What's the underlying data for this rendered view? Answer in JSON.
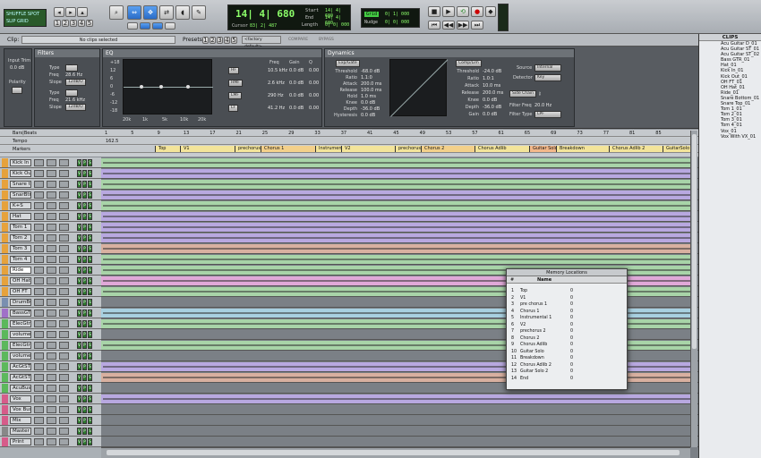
{
  "toolbar": {
    "mode_top": "SHUFFLE SPOT",
    "mode_bottom": "SLIP GRID",
    "main_counter": "14| 4| 680",
    "cursor_label": "Cursor",
    "cursor_value": "83| 2| 487",
    "start_label": "Start",
    "start_value": "14| 4| 680",
    "end_label": "End",
    "end_value": "14| 4| 680",
    "length_label": "Length",
    "length_value": "0| 0| 000",
    "grid_label": "Grid",
    "grid_value": "0| 1| 000",
    "nudge_label": "Nudge",
    "nudge_value": "0| 0| 000",
    "dly": "Dly"
  },
  "editbar": {
    "clip_label": "Clip:",
    "clip_value": "No clips selected",
    "presets_label": "Presets:",
    "preset_value": "<factory default>",
    "compare": "COMPARE",
    "bypass": "BYPASS"
  },
  "filters": {
    "title": "Filters",
    "input_trim_label": "Input Trim",
    "input_trim_value": "0.0 dB",
    "polarity_label": "Polarity",
    "rows": [
      {
        "type": "Type",
        "freq": "Freq",
        "freq_val": "28.6 Hz",
        "slope": "Slope",
        "slope_val": "12dB/O"
      },
      {
        "type": "Type",
        "freq": "Freq",
        "freq_val": "21.6 kHz",
        "slope": "Slope",
        "slope_val": "12dB/O"
      }
    ]
  },
  "eq": {
    "title": "EQ",
    "ylabels": [
      "+18",
      "12",
      "6",
      "0",
      "-6",
      "-12",
      "-18"
    ],
    "xlabels": [
      "20k",
      "1k",
      "5k",
      "10k",
      "20k"
    ],
    "bands": [
      "HF",
      "HMF",
      "LMF",
      "LF"
    ],
    "col_headers": [
      "Freq",
      "Gain",
      "Q"
    ],
    "band_rows": [
      {
        "freq": "10.5 kHz",
        "gain": "0.0 dB",
        "q": "0.00"
      },
      {
        "freq": "2.6 kHz",
        "gain": "0.0 dB",
        "q": "0.00"
      },
      {
        "freq": "290 Hz",
        "gain": "0.0 dB",
        "q": "0.00"
      },
      {
        "freq": "41.2 Hz",
        "gain": "0.0 dB",
        "q": "0.00"
      }
    ]
  },
  "dynamics": {
    "title": "Dynamics",
    "gate_label": "Exp/Gate",
    "gate_params": [
      {
        "label": "Threshold",
        "value": "-68.0 dB"
      },
      {
        "label": "Ratio",
        "value": "1.1:0"
      },
      {
        "label": "Attack",
        "value": "200.0 ms"
      },
      {
        "label": "Release",
        "value": "100.0 ms"
      },
      {
        "label": "Hold",
        "value": "1.0 ms"
      },
      {
        "label": "Knee",
        "value": "0.0 dB"
      },
      {
        "label": "Depth",
        "value": "-36.0 dB"
      },
      {
        "label": "Hysteresis",
        "value": "0.0 dB"
      }
    ],
    "comp_label": "Comp/Lim",
    "comp_params": [
      {
        "label": "Threshold",
        "value": "-24.0 dB"
      },
      {
        "label": "Ratio",
        "value": "1.0:1"
      },
      {
        "label": "Attack",
        "value": "10.0 ms"
      },
      {
        "label": "Release",
        "value": "200.0 ms"
      },
      {
        "label": "Knee",
        "value": "0.0 dB"
      },
      {
        "label": "Depth",
        "value": "-36.0 dB"
      },
      {
        "label": "Gain",
        "value": "0.0 dB"
      }
    ],
    "source_label": "Source",
    "source_value": "Internal",
    "detector_label": "Detector",
    "detector_value": "Key",
    "sidechain_label": "Side Chain",
    "filter_freq_label": "Filter Freq",
    "filter_freq_value": "20.0 Hz",
    "filter_type_label": "Filter Type",
    "filter_type_value": "LPF"
  },
  "clips": {
    "title": "CLIPS",
    "items": [
      "Acu Guitar D_01",
      "Acu Guitar ST_01",
      "Acu Guitar ST_02",
      "Bass GTR_01",
      "Hat_01",
      "Kick In_01",
      "Kick Out_01",
      "OH FT_01",
      "OH Hat_01",
      "Ride_01",
      "Snare Bottom_01",
      "Snare Top_01",
      "Tom 1_01",
      "Tom 2_01",
      "Tom 3_01",
      "Tom 4_01",
      "Vox_01",
      "Vox With VX_01"
    ]
  },
  "rulers": {
    "bars_label": "Bars|Beats",
    "bar_numbers": [
      "1",
      "5",
      "9",
      "13",
      "17",
      "21",
      "25",
      "29",
      "33",
      "37",
      "41",
      "45",
      "49",
      "53",
      "57",
      "61",
      "65",
      "69",
      "73",
      "77",
      "81",
      "85"
    ],
    "tempo_label": "Tempo",
    "tempo_value": "162.5",
    "markers_label": "Markers",
    "markers": [
      "Top",
      "V1",
      "prechorus 1",
      "Chorus 1",
      "Instrumental 1",
      "V2",
      "prechorus 2",
      "Chorus 2",
      "Chorus Adlib",
      "Guitar Solo",
      "Breakdown",
      "Chorus Adlib 2",
      "GuitarSolo 2"
    ]
  },
  "tracks": [
    {
      "name": "Kick In",
      "color": "#e6a23c"
    },
    {
      "name": "Kick Out",
      "color": "#e6a23c"
    },
    {
      "name": "Snare t",
      "color": "#e6a23c"
    },
    {
      "name": "SnarBtm",
      "color": "#e6a23c"
    },
    {
      "name": "K+S",
      "color": "#e6a23c"
    },
    {
      "name": "Hat",
      "color": "#e6a23c"
    },
    {
      "name": "Tom 1",
      "color": "#e6a23c"
    },
    {
      "name": "Tom 2",
      "color": "#e6a23c"
    },
    {
      "name": "Tom 3",
      "color": "#e6a23c"
    },
    {
      "name": "Tom 4",
      "color": "#e6a23c"
    },
    {
      "name": "Ride",
      "color": "#e6a23c"
    },
    {
      "name": "OH Hat",
      "color": "#e6a23c"
    },
    {
      "name": "OH FT",
      "color": "#e6a23c"
    },
    {
      "name": "DrumBus",
      "color": "#7a8fb0"
    },
    {
      "name": "BassGTR",
      "color": "#a070c8"
    },
    {
      "name": "ElecGtr1",
      "color": "#5cb85c"
    },
    {
      "name": "volume",
      "color": "#5cb85c"
    },
    {
      "name": "ElecGtr2",
      "color": "#5cb85c"
    },
    {
      "name": "volume",
      "color": "#5cb85c"
    },
    {
      "name": "AcGtSTL",
      "color": "#5cb85c"
    },
    {
      "name": "AcGtSTR",
      "color": "#5cb85c"
    },
    {
      "name": "AcuBuss",
      "color": "#5cb85c"
    },
    {
      "name": "Vox",
      "color": "#d65c8a"
    },
    {
      "name": "Vox Buss",
      "color": "#d65c8a"
    },
    {
      "name": "Mix",
      "color": "#d65c8a"
    },
    {
      "name": "Master 1",
      "color": "#888888"
    },
    {
      "name": "Print",
      "color": "#d65c8a"
    }
  ],
  "memory_locations": {
    "title": "Memory Locations",
    "col_hash": "#",
    "col_name": "Name",
    "rows": [
      {
        "n": "1",
        "name": "Top",
        "v": "0"
      },
      {
        "n": "2",
        "name": "V1",
        "v": "0"
      },
      {
        "n": "3",
        "name": "pre chorus 1",
        "v": "0"
      },
      {
        "n": "4",
        "name": "Chorus 1",
        "v": "0"
      },
      {
        "n": "5",
        "name": "Instrumental 1",
        "v": "0"
      },
      {
        "n": "6",
        "name": "V2",
        "v": "0"
      },
      {
        "n": "7",
        "name": "prechorus 2",
        "v": "0"
      },
      {
        "n": "8",
        "name": "Chorus 2",
        "v": "0"
      },
      {
        "n": "9",
        "name": "Chorus Adlib",
        "v": "0"
      },
      {
        "n": "10",
        "name": "Guitar Solo",
        "v": "0"
      },
      {
        "n": "11",
        "name": "Breakdown",
        "v": "0"
      },
      {
        "n": "12",
        "name": "Chorus Adlib 2",
        "v": "0"
      },
      {
        "n": "13",
        "name": "Guitar Solo 2",
        "v": "0"
      },
      {
        "n": "14",
        "name": "End",
        "v": "0"
      }
    ]
  },
  "master_value": "0.0"
}
